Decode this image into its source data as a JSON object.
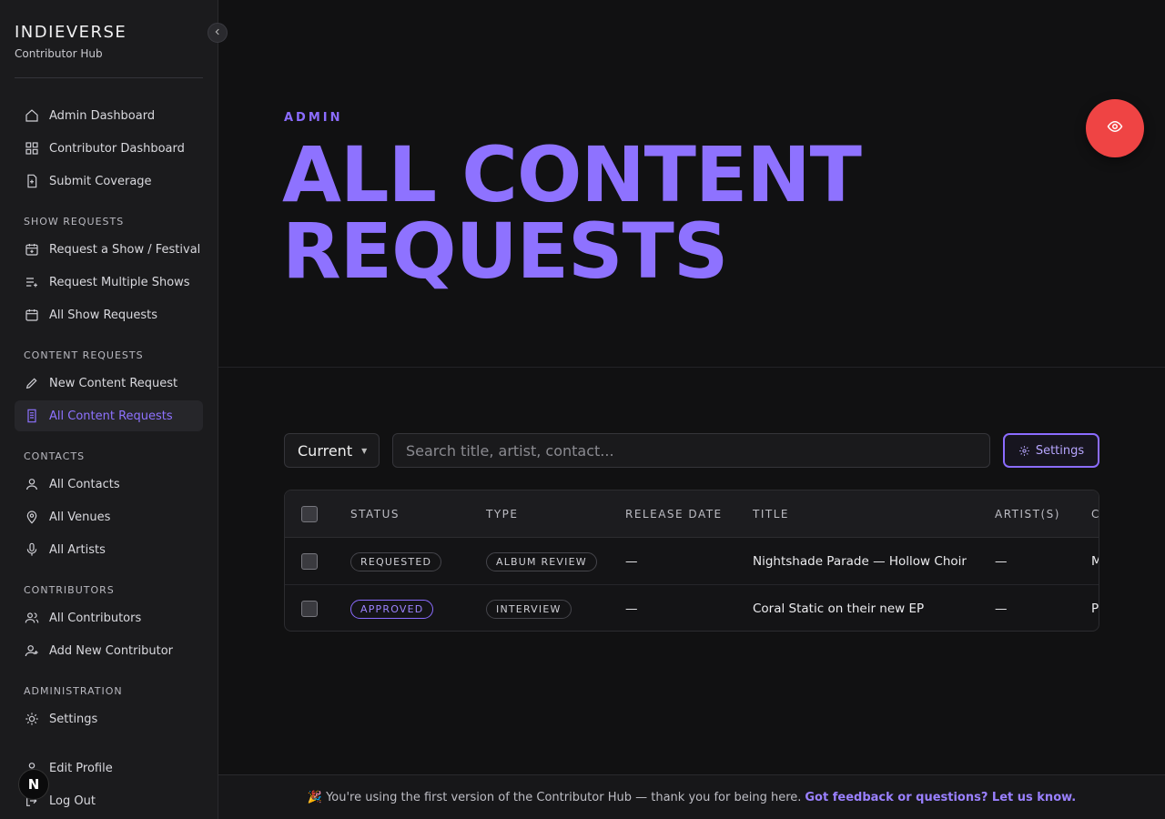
{
  "brand": {
    "title": "INDIEVERSE",
    "subtitle": "Contributor Hub"
  },
  "sidebar": {
    "items": [
      {
        "label": "Admin Dashboard",
        "icon": "home-icon"
      },
      {
        "label": "Contributor Dashboard",
        "icon": "grid-icon"
      },
      {
        "label": "Submit Coverage",
        "icon": "file-plus-icon"
      },
      {
        "label": "Request a Show / Festival",
        "icon": "calendar-plus-icon"
      },
      {
        "label": "Request Multiple Shows",
        "icon": "list-plus-icon"
      },
      {
        "label": "All Show Requests",
        "icon": "calendar-icon"
      },
      {
        "label": "New Content Request",
        "icon": "pencil-icon"
      },
      {
        "label": "All Content Requests",
        "icon": "document-icon",
        "active": true
      },
      {
        "label": "All Contacts",
        "icon": "user-icon"
      },
      {
        "label": "All Venues",
        "icon": "map-pin-icon"
      },
      {
        "label": "All Artists",
        "icon": "microphone-icon"
      },
      {
        "label": "All Contributors",
        "icon": "users-icon"
      },
      {
        "label": "Add New Contributor",
        "icon": "user-plus-icon"
      },
      {
        "label": "Settings",
        "icon": "sun-gear-icon"
      },
      {
        "label": "Edit Profile",
        "icon": "user-icon"
      },
      {
        "label": "Log Out",
        "icon": "logout-icon"
      }
    ],
    "sections": [
      "SHOW REQUESTS",
      "CONTENT REQUESTS",
      "CONTACTS",
      "CONTRIBUTORS",
      "ADMINISTRATION"
    ]
  },
  "page": {
    "eyebrow": "ADMIN",
    "title_line1": "ALL CONTENT",
    "title_line2": "REQUESTS"
  },
  "filters": {
    "select_value": "Current",
    "search_placeholder": "Search title, artist, contact...",
    "settings_label": "Settings"
  },
  "table": {
    "headers": [
      "STATUS",
      "TYPE",
      "RELEASE DATE",
      "TITLE",
      "ARTIST(S)",
      "C"
    ],
    "rows": [
      {
        "status": "REQUESTED",
        "type": "ALBUM REVIEW",
        "release_date": "—",
        "title": "Nightshade Parade — Hollow Choir",
        "artists": "—",
        "contact": "M"
      },
      {
        "status": "APPROVED",
        "type": "INTERVIEW",
        "release_date": "—",
        "title": "Coral Static on their new EP",
        "artists": "—",
        "contact": "P"
      }
    ]
  },
  "footer": {
    "message": "🎉 You're using the first version of the Contributor Hub — thank you for being here.",
    "link": "Got feedback or questions? Let us know."
  },
  "colors": {
    "accent": "#8e72ff",
    "danger": "#ef4444",
    "bg": "#111112",
    "sidebar": "#1b1b1d"
  }
}
